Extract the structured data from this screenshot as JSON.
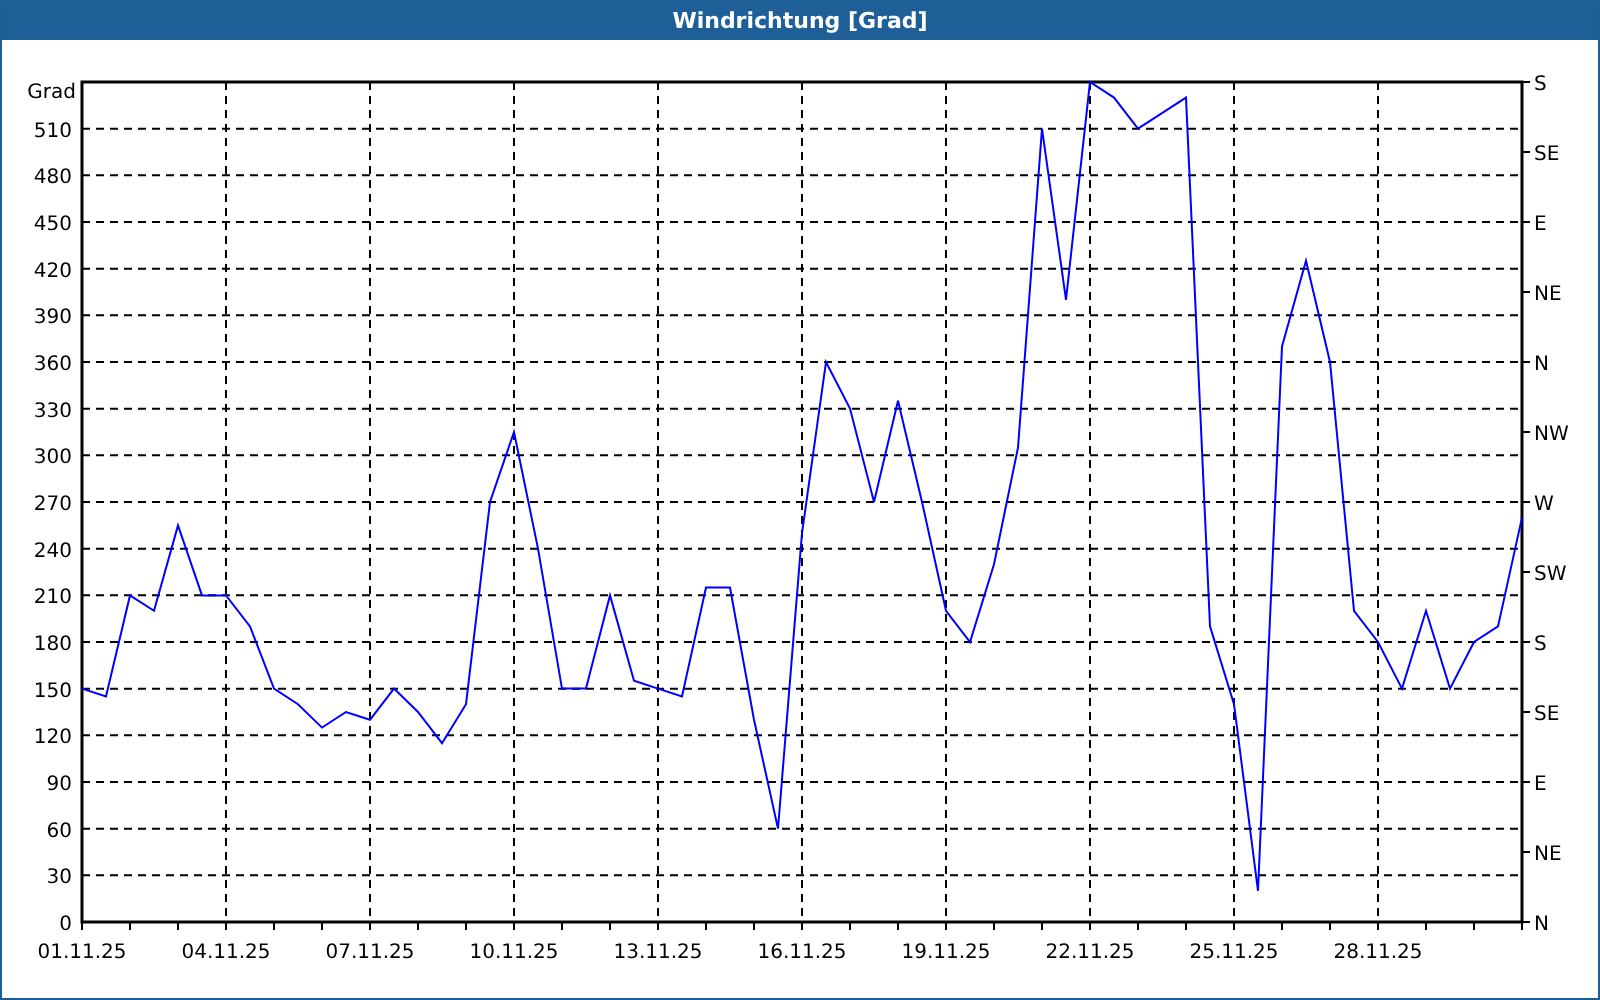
{
  "window": {
    "title": "Windrichtung [Grad]"
  },
  "chart": {
    "right_axis_labels": [
      "S",
      "SE",
      "E",
      "NE",
      "N",
      "NW",
      "W",
      "SW",
      "S",
      "SE",
      "E",
      "NE",
      "N"
    ],
    "chart_data": {
      "type": "line",
      "grid": true,
      "ylabel": "Grad",
      "ylim": [
        0,
        540
      ],
      "categories": [
        "01.11.25",
        null,
        null,
        null,
        null,
        null,
        "04.11.25",
        null,
        null,
        null,
        null,
        null,
        "07.11.25",
        null,
        null,
        null,
        null,
        null,
        "10.11.25",
        null,
        null,
        null,
        null,
        null,
        "13.11.25",
        null,
        null,
        null,
        null,
        null,
        "16.11.25",
        null,
        null,
        null,
        null,
        null,
        "19.11.25",
        null,
        null,
        null,
        null,
        null,
        "22.11.25",
        null,
        null,
        null,
        null,
        null,
        "25.11.25",
        null,
        null,
        null,
        null,
        null,
        "28.11.25",
        null,
        null,
        null,
        null,
        null,
        null
      ],
      "yticks": [
        0,
        30,
        60,
        90,
        120,
        150,
        180,
        210,
        240,
        270,
        300,
        330,
        360,
        390,
        420,
        450,
        480,
        510
      ],
      "series": [
        {
          "color": "#0000ff",
          "values": [
            150,
            145,
            210,
            200,
            255,
            210,
            210,
            190,
            150,
            140,
            125,
            135,
            130,
            150,
            135,
            115,
            140,
            270,
            315,
            240,
            150,
            150,
            210,
            155,
            150,
            145,
            215,
            215,
            130,
            60,
            250,
            360,
            330,
            270,
            335,
            270,
            200,
            180,
            230,
            305,
            510,
            400,
            540,
            530,
            510,
            520,
            530,
            190,
            140,
            20,
            370,
            425,
            360,
            200,
            180,
            150,
            200,
            150,
            180,
            190,
            260
          ]
        }
      ]
    }
  }
}
